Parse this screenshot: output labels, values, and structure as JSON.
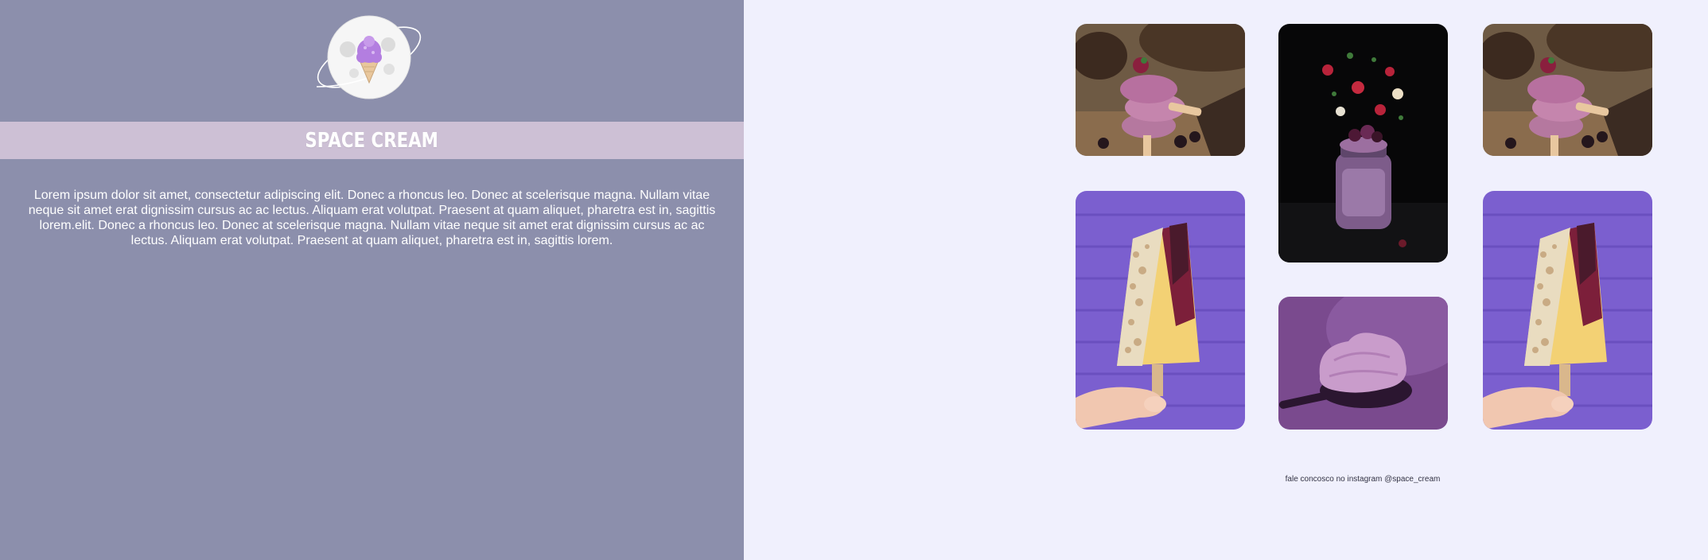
{
  "brand": {
    "logo_icon": "ice-cream-planet-logo",
    "title": "SPACE CREAM"
  },
  "intro": {
    "text": "Lorem ipsum dolor sit amet, consectetur adipiscing elit. Donec a rhoncus leo. Donec at scelerisque magna. Nullam vitae neque sit amet erat dignissim cursus ac ac lectus. Aliquam erat volutpat. Praesent at quam aliquet, pharetra est in, sagittis lorem.elit. Donec a rhoncus leo. Donec at scelerisque magna. Nullam vitae neque sit amet erat dignissim cursus ac ac lectus. Aliquam erat volutpat. Praesent at quam aliquet, pharetra est in, sagittis lorem."
  },
  "gallery": {
    "photos": [
      {
        "subject": "stacked purple popsicles with blackberries"
      },
      {
        "subject": "smoothie jar with flying berries"
      },
      {
        "subject": "stacked purple popsicles with blackberries"
      },
      {
        "subject": "granola popsicle held in hand"
      },
      {
        "subject": "scoop of purple ice cream"
      },
      {
        "subject": "granola popsicle held in hand"
      }
    ]
  },
  "footer": {
    "instagram_text": "fale concosco no instagram @space_cream"
  },
  "colors": {
    "sidebar_bg": "#8c8fac",
    "title_band_bg": "#cdc0d5",
    "page_bg": "#f0f0fd"
  }
}
